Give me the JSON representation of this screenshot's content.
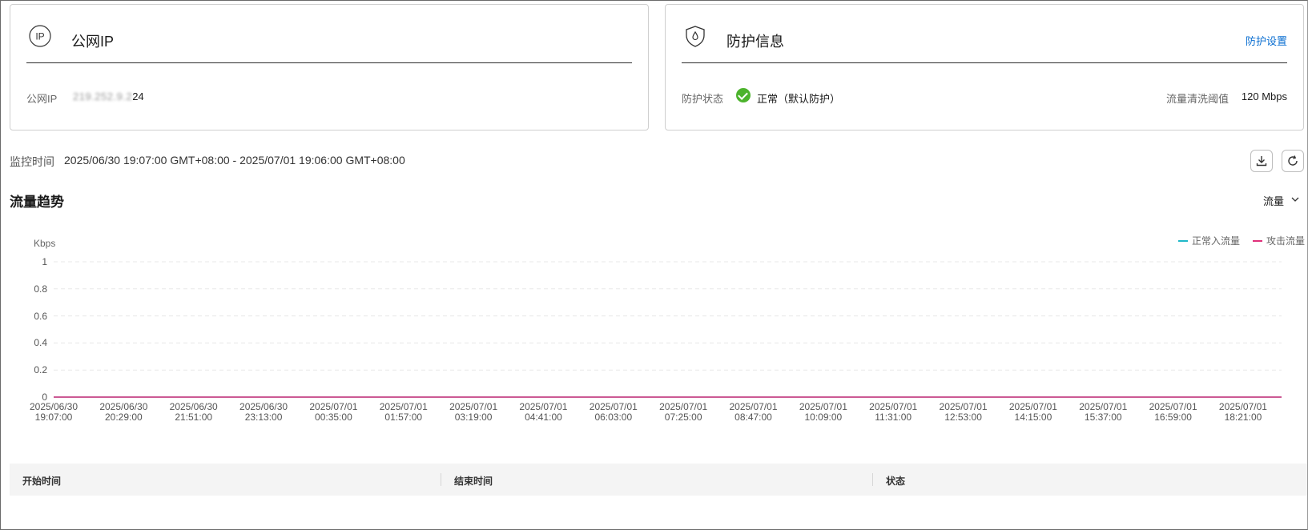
{
  "public_ip_card": {
    "title": "公网IP",
    "icon": "ip-circle-icon",
    "ip_label": "公网IP",
    "ip_value_masked": "219.252.9.2",
    "ip_value_suffix": "24"
  },
  "protection_card": {
    "title": "防护信息",
    "icon": "shield-drop-icon",
    "settings_link": "防护设置",
    "status_label": "防护状态",
    "status_value": "正常（默认防护）",
    "threshold_label": "流量清洗阈值",
    "threshold_value": "120 Mbps"
  },
  "monitor": {
    "label": "监控时间",
    "range": "2025/06/30 19:07:00 GMT+08:00 - 2025/07/01 19:06:00 GMT+08:00"
  },
  "traffic": {
    "title": "流量趋势",
    "metric_selected": "流量"
  },
  "colors": {
    "normal_in": "#1fb8c8",
    "attack": "#e0307a",
    "link": "#0a6ed1",
    "status_ok": "#4cb32c"
  },
  "chart_data": {
    "type": "line",
    "ylabel": "Kbps",
    "ylim": [
      0,
      1
    ],
    "y_ticks": [
      "0",
      "0.2",
      "0.4",
      "0.6",
      "0.8",
      "1"
    ],
    "categories": [
      [
        "2025/06/30",
        "19:07:00"
      ],
      [
        "2025/06/30",
        "20:29:00"
      ],
      [
        "2025/06/30",
        "21:51:00"
      ],
      [
        "2025/06/30",
        "23:13:00"
      ],
      [
        "2025/07/01",
        "00:35:00"
      ],
      [
        "2025/07/01",
        "01:57:00"
      ],
      [
        "2025/07/01",
        "03:19:00"
      ],
      [
        "2025/07/01",
        "04:41:00"
      ],
      [
        "2025/07/01",
        "06:03:00"
      ],
      [
        "2025/07/01",
        "07:25:00"
      ],
      [
        "2025/07/01",
        "08:47:00"
      ],
      [
        "2025/07/01",
        "10:09:00"
      ],
      [
        "2025/07/01",
        "11:31:00"
      ],
      [
        "2025/07/01",
        "12:53:00"
      ],
      [
        "2025/07/01",
        "14:15:00"
      ],
      [
        "2025/07/01",
        "15:37:00"
      ],
      [
        "2025/07/01",
        "16:59:00"
      ],
      [
        "2025/07/01",
        "18:21:00"
      ]
    ],
    "series": [
      {
        "name": "正常入流量",
        "color": "#1fb8c8",
        "values": [
          0,
          0,
          0,
          0,
          0,
          0,
          0,
          0,
          0,
          0,
          0,
          0,
          0,
          0,
          0,
          0,
          0,
          0
        ]
      },
      {
        "name": "攻击流量",
        "color": "#e0307a",
        "values": [
          0,
          0,
          0,
          0,
          0,
          0,
          0,
          0,
          0,
          0,
          0,
          0,
          0,
          0,
          0,
          0,
          0,
          0
        ]
      }
    ],
    "grid": true,
    "legend_position": "top-right"
  },
  "events_table": {
    "columns": [
      "开始时间",
      "结束时间",
      "状态"
    ]
  }
}
